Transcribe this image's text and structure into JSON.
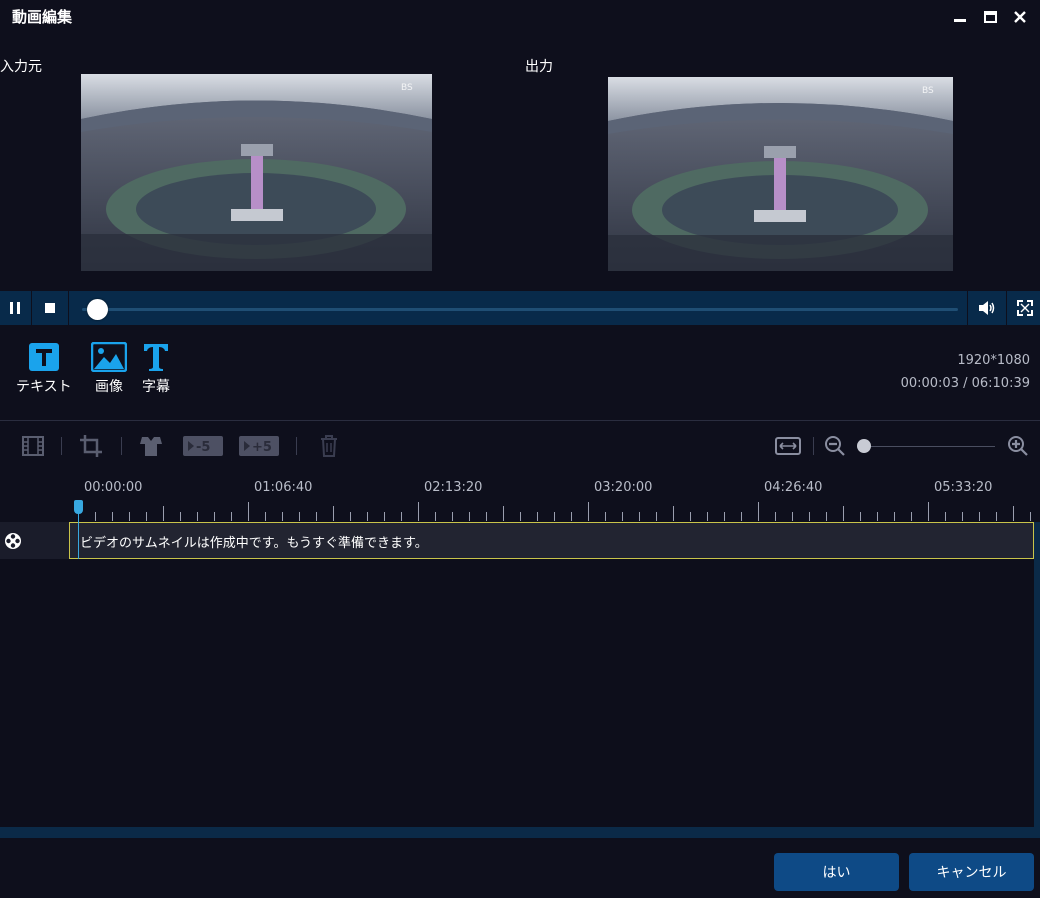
{
  "window": {
    "title": "動画編集"
  },
  "panes": {
    "source_label": "入力元",
    "output_label": "出力"
  },
  "tools": [
    {
      "label": "テキスト",
      "icon": "text-insert-icon"
    },
    {
      "label": "画像",
      "icon": "image-icon"
    },
    {
      "label": "字幕",
      "icon": "subtitle-icon"
    }
  ],
  "info": {
    "resolution": "1920*1080",
    "time": "00:00:03 / 06:10:39"
  },
  "playback": {
    "position_fraction": 0.008
  },
  "toolbar": {
    "back5_label": "-5",
    "fwd5_label": "+5"
  },
  "timeline": {
    "ticks": [
      "00:00:00",
      "01:06:40",
      "02:13:20",
      "03:20:00",
      "04:26:40",
      "05:33:20"
    ],
    "track_message": "ビデオのサムネイルは作成中です。もうすぐ準備できます。"
  },
  "zoom": {
    "level_fraction": 0.0
  },
  "buttons": {
    "ok": "はい",
    "cancel": "キャンセル"
  },
  "colors": {
    "accent": "#0e4a86",
    "playbar": "#082a4a",
    "clip_border": "#c9c44a",
    "playhead": "#38a8e0",
    "tool_blue": "#1aa3ec"
  }
}
